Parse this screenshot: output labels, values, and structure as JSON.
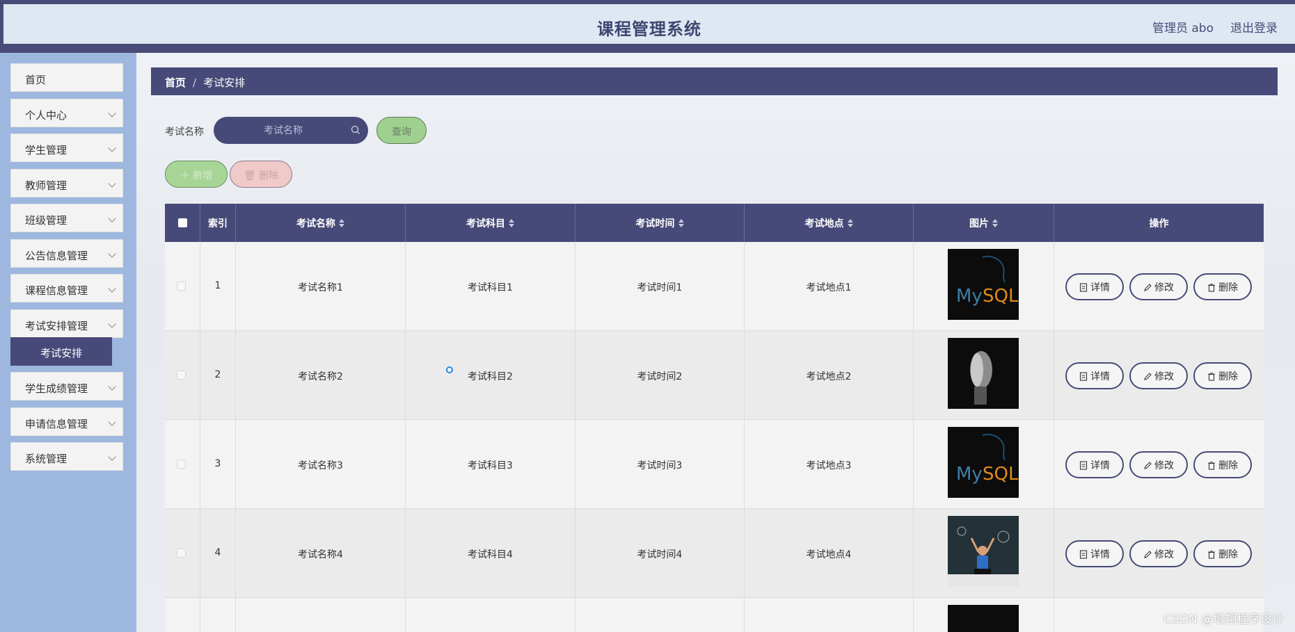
{
  "header": {
    "title": "课程管理系统",
    "user": "管理员 abo",
    "logout": "退出登录"
  },
  "sidebar": {
    "items": [
      {
        "label": "首页",
        "expandable": false
      },
      {
        "label": "个人中心",
        "expandable": true
      },
      {
        "label": "学生管理",
        "expandable": true
      },
      {
        "label": "教师管理",
        "expandable": true
      },
      {
        "label": "班级管理",
        "expandable": true
      },
      {
        "label": "公告信息管理",
        "expandable": true
      },
      {
        "label": "课程信息管理",
        "expandable": true
      },
      {
        "label": "考试安排管理",
        "expandable": true,
        "expanded": true
      },
      {
        "label": "学生成绩管理",
        "expandable": true
      },
      {
        "label": "申请信息管理",
        "expandable": true
      },
      {
        "label": "系统管理",
        "expandable": true
      }
    ],
    "active_sub": "考试安排"
  },
  "breadcrumb": {
    "home": "首页",
    "separator": "/",
    "current": "考试安排"
  },
  "search": {
    "label": "考试名称",
    "placeholder": "考试名称",
    "query_button": "查询"
  },
  "actions": {
    "add": "新增",
    "delete": "删除"
  },
  "table": {
    "columns": [
      "索引",
      "考试名称",
      "考试科目",
      "考试时间",
      "考试地点",
      "图片",
      "操作"
    ],
    "rows": [
      {
        "index": "1",
        "name": "考试名称1",
        "subject": "考试科目1",
        "time": "考试时间1",
        "place": "考试地点1",
        "image": "mysql-logo"
      },
      {
        "index": "2",
        "name": "考试名称2",
        "subject": "考试科目2",
        "time": "考试时间2",
        "place": "考试地点2",
        "image": "robot-face"
      },
      {
        "index": "3",
        "name": "考试名称3",
        "subject": "考试科目3",
        "time": "考试时间3",
        "place": "考试地点3",
        "image": "mysql-logo"
      },
      {
        "index": "4",
        "name": "考试名称4",
        "subject": "考试科目4",
        "time": "考试时间4",
        "place": "考试地点4",
        "image": "person-chalkboard"
      }
    ],
    "row_actions": {
      "detail": "详情",
      "edit": "修改",
      "delete": "删除"
    }
  },
  "watermark": "CSDN @增翔程序设计",
  "colors": {
    "primary": "#474a78",
    "sidebar_bg": "#9db7de",
    "query_green": "#9fd08f",
    "delete_pink": "#f0c9c9"
  }
}
